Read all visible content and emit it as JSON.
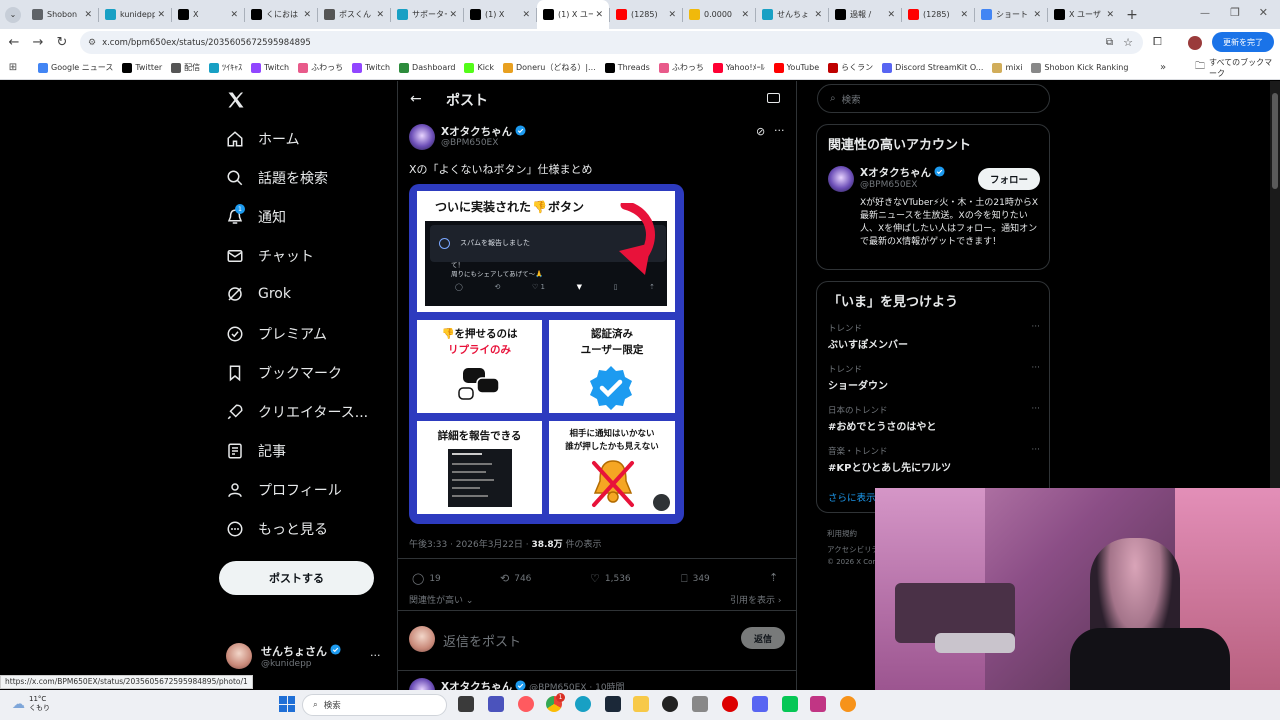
{
  "browser": {
    "tabs": [
      {
        "label": "Shobon",
        "icon": "tabs-menu-icon",
        "color": "#5f6368"
      },
      {
        "label": "kunidepp",
        "icon": "kick-icon",
        "color": "#18a0c4"
      },
      {
        "label": "X",
        "icon": "x-icon",
        "color": "#000000"
      },
      {
        "label": "くにおは",
        "icon": "x-icon",
        "color": "#000000"
      },
      {
        "label": "ポスくん",
        "icon": "globe-icon",
        "color": "#555555"
      },
      {
        "label": "サポーター",
        "icon": "kick-icon",
        "color": "#18a0c4"
      },
      {
        "label": "(1) X",
        "icon": "x-icon",
        "color": "#000000"
      },
      {
        "label": "(1) X ユー",
        "icon": "x-icon",
        "color": "#000000"
      },
      {
        "label": "(1285)",
        "icon": "youtube-icon",
        "color": "#ff0000"
      },
      {
        "label": "0.0000",
        "icon": "coin-icon",
        "color": "#f0b90b"
      },
      {
        "label": "せんちょ",
        "icon": "kick-icon",
        "color": "#18a0c4"
      },
      {
        "label": "過報 /",
        "icon": "x-icon",
        "color": "#000000"
      },
      {
        "label": "(1285)",
        "icon": "youtube-icon",
        "color": "#ff0000"
      },
      {
        "label": "ショート",
        "icon": "google-icon",
        "color": "#4285f4"
      },
      {
        "label": "X ユーザ",
        "icon": "x-icon",
        "color": "#000000"
      }
    ],
    "active_tab_index": 7,
    "url": "x.com/bpm650ex/status/2035605672595984895",
    "update_label": "更新を完了",
    "bookmarks": [
      {
        "label": "Google ニュース",
        "color": "#4285f4"
      },
      {
        "label": "Twitter",
        "color": "#000000"
      },
      {
        "label": "配信",
        "color": "#555555"
      },
      {
        "label": "ﾂｲｷｬｽ",
        "color": "#18a0c4"
      },
      {
        "label": "Twitch",
        "color": "#9146ff"
      },
      {
        "label": "ふわっち",
        "color": "#e85a8a"
      },
      {
        "label": "Twitch",
        "color": "#9146ff"
      },
      {
        "label": "Dashboard",
        "color": "#2d8c3c"
      },
      {
        "label": "Kick",
        "color": "#53fc18"
      },
      {
        "label": "Doneru（どねる）|...",
        "color": "#e8a020"
      },
      {
        "label": "Threads",
        "color": "#000000"
      },
      {
        "label": "ふわっち",
        "color": "#e85a8a"
      },
      {
        "label": "Yahoo!ﾒｰﾙ",
        "color": "#ff0033"
      },
      {
        "label": "YouTube",
        "color": "#ff0000"
      },
      {
        "label": "らくラン",
        "color": "#bf0000"
      },
      {
        "label": "Discord StreamKit O...",
        "color": "#5865f2"
      },
      {
        "label": "mixi",
        "color": "#d1ad5a"
      },
      {
        "label": "Shobon Kick Ranking",
        "color": "#888888"
      }
    ],
    "all_bookmarks": "すべてのブックマーク",
    "status_url": "https://x.com/BPM650EX/status/2035605672595984895/photo/1"
  },
  "nav": {
    "items": [
      {
        "label": "ホーム",
        "icon": "home-icon"
      },
      {
        "label": "話題を検索",
        "icon": "search-icon"
      },
      {
        "label": "通知",
        "icon": "bell-icon",
        "badge": "1"
      },
      {
        "label": "チャット",
        "icon": "mail-icon"
      },
      {
        "label": "Grok",
        "icon": "grok-icon"
      },
      {
        "label": "プレミアム",
        "icon": "verified-icon"
      },
      {
        "label": "ブックマーク",
        "icon": "bookmark-icon"
      },
      {
        "label": "クリエイタース...",
        "icon": "rocket-icon"
      },
      {
        "label": "記事",
        "icon": "article-icon"
      },
      {
        "label": "プロフィール",
        "icon": "person-icon"
      },
      {
        "label": "もっと見る",
        "icon": "more-circle-icon"
      }
    ],
    "post_button": "ポストする",
    "account": {
      "name": "せんちょさん",
      "handle": "@kunidepp"
    }
  },
  "main": {
    "header_title": "ポスト",
    "author": {
      "name": "Xオタクちゃん",
      "handle": "@BPM650EX"
    },
    "post_text": "Xの「よくないねボタン」仕様まとめ",
    "image": {
      "title_a": "ついに実装された",
      "title_b": "ボタン",
      "inner_notice": "スパムを報告しました",
      "inner_line1": "て！",
      "inner_line2": "周りにもシェアしてあげて〜🙏",
      "inner_like": "1",
      "card1_a": "を押せるのは",
      "card1_b": "リプライのみ",
      "card2_a": "認証済み",
      "card2_b": "ユーザー限定",
      "card3": "詳細を報告できる",
      "card4_a": "相手に通知はいかない",
      "card4_b": "誰が押したかも見えない"
    },
    "meta": {
      "time": "午後3:33 · 2026年3月22日 · ",
      "views": "38.8万",
      "views_label": " 件の表示"
    },
    "stats": {
      "replies": "19",
      "reposts": "746",
      "likes": "1,536",
      "bookmarks": "349"
    },
    "sort_label": "関連性が高い",
    "quote_label": "引用を表示",
    "reply_placeholder": "返信をポスト",
    "reply_button": "返信",
    "next_post": {
      "name": "Xオタクちゃん",
      "handle": "@BPM650EX · 10時間"
    }
  },
  "right": {
    "search_placeholder": "検索",
    "related_title": "関連性の高いアカウント",
    "related": {
      "name": "Xオタクちゃん",
      "handle": "@BPM650EX",
      "follow": "フォロー",
      "bio": "Xが好きなVTuber⚡火・木・土の21時からX最新ニュースを生放送。Xの今を知りたい人、Xを伸ばしたい人はフォロー。通知オンで最新のX情報がゲットできます！"
    },
    "trends_title": "「いま」を見つけよう",
    "trends": [
      {
        "label": "トレンド",
        "text": "ぶいすぽメンバー"
      },
      {
        "label": "トレンド",
        "text": "ショーダウン"
      },
      {
        "label": "日本のトレンド",
        "text": "#おめでとうさのはやと"
      },
      {
        "label": "音楽・トレンド",
        "text": "#KPとひとあし先にワルツ"
      }
    ],
    "show_more": "さらに表示",
    "footer1": "利用規約",
    "footer2": "アクセシビリティ",
    "footer3": "© 2026 X Corp."
  },
  "taskbar": {
    "weather_temp": "11°C",
    "weather_desc": "くもり",
    "search": "検索",
    "notify_badge": "1"
  }
}
